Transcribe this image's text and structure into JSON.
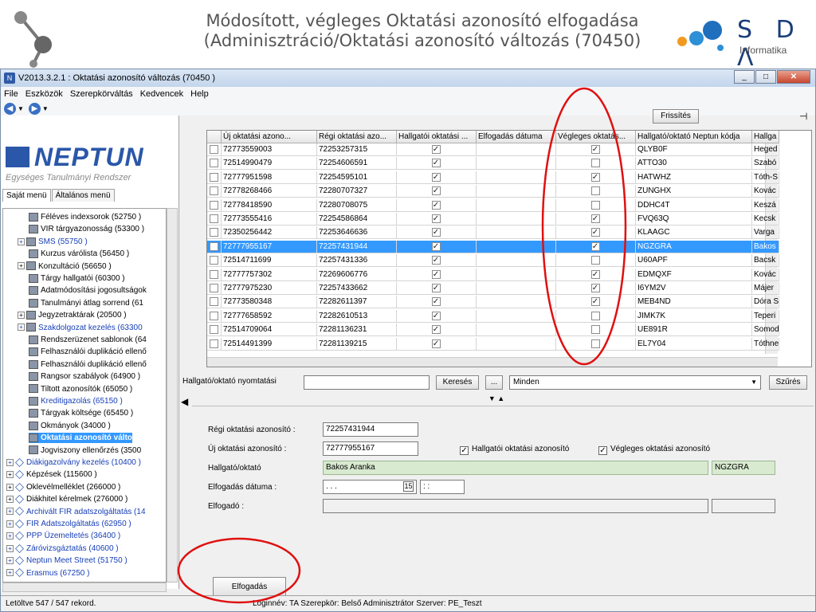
{
  "slide": {
    "title_line1": "Módosított, végleges  Oktatási azonosító elfogadása",
    "title_line2": "(Adminisztráció/Oktatási azonosító változás (70450)",
    "logo_letters": "S D Λ",
    "logo_sub": "Informatika"
  },
  "window": {
    "title": "V2013.3.2.1 : Oktatási azonosító változás (70450  )"
  },
  "menu": [
    "File",
    "Eszközök",
    "Szerepkörváltás",
    "Kedvencek",
    "Help"
  ],
  "brand": {
    "name": "NEPTUN",
    "subtitle": "Egységes Tanulmányi Rendszer"
  },
  "tabs": [
    "Saját menü",
    "Általános menü"
  ],
  "tree": [
    {
      "label": "Féléves indexsorok (52750 )",
      "indent": 2,
      "type": "node",
      "exp": "",
      "blue": false
    },
    {
      "label": "VIR tárgyazonosság (53300 )",
      "indent": 2,
      "type": "node",
      "exp": "",
      "blue": false
    },
    {
      "label": "SMS (55750 )",
      "indent": 1,
      "type": "node",
      "exp": "+",
      "blue": true
    },
    {
      "label": "Kurzus várólista (56450 )",
      "indent": 2,
      "type": "node",
      "exp": "",
      "blue": false
    },
    {
      "label": "Konzultáció (56650 )",
      "indent": 1,
      "type": "node",
      "exp": "+",
      "blue": false
    },
    {
      "label": "Tárgy hallgatói (60300 )",
      "indent": 2,
      "type": "node",
      "exp": "",
      "blue": false
    },
    {
      "label": "Adatmódosítási jogosultságok",
      "indent": 2,
      "type": "node",
      "exp": "",
      "blue": false
    },
    {
      "label": "Tanulmányi átlag sorrend (61",
      "indent": 2,
      "type": "node",
      "exp": "",
      "blue": false
    },
    {
      "label": "Jegyzetraktárak (20500 )",
      "indent": 1,
      "type": "node",
      "exp": "+",
      "blue": false
    },
    {
      "label": "Szakdolgozat kezelés (63300",
      "indent": 1,
      "type": "node",
      "exp": "+",
      "blue": true
    },
    {
      "label": "Rendszerüzenet sablonok (64",
      "indent": 2,
      "type": "node",
      "exp": "",
      "blue": false
    },
    {
      "label": "Felhasználói duplikáció ellenő",
      "indent": 2,
      "type": "node",
      "exp": "",
      "blue": false
    },
    {
      "label": "Felhasználói duplikáció ellenő",
      "indent": 2,
      "type": "node",
      "exp": "",
      "blue": false
    },
    {
      "label": "Rangsor szabályok (64900 )",
      "indent": 2,
      "type": "node",
      "exp": "",
      "blue": false
    },
    {
      "label": "Tiltott azonosítók (65050 )",
      "indent": 2,
      "type": "node",
      "exp": "",
      "blue": false
    },
    {
      "label": "Kreditigazolás (65150 )",
      "indent": 2,
      "type": "node",
      "exp": "",
      "blue": true
    },
    {
      "label": "Tárgyak költsége (65450 )",
      "indent": 2,
      "type": "node",
      "exp": "",
      "blue": false
    },
    {
      "label": "Okmányok (34000 )",
      "indent": 2,
      "type": "node",
      "exp": "",
      "blue": false
    },
    {
      "label": "Oktatási azonosító válto",
      "indent": 2,
      "type": "node",
      "exp": "",
      "blue": false,
      "selected": true
    },
    {
      "label": "Jogviszony ellenőrzés (3500",
      "indent": 2,
      "type": "node",
      "exp": "",
      "blue": false
    },
    {
      "label": "Diákigazolvány kezelés (10400 )",
      "indent": 0,
      "type": "dia",
      "exp": "+",
      "blue": true
    },
    {
      "label": "Képzések (115600 )",
      "indent": 0,
      "type": "dia",
      "exp": "+",
      "blue": false
    },
    {
      "label": "Oklevélmelléklet (266000 )",
      "indent": 0,
      "type": "dia",
      "exp": "+",
      "blue": false
    },
    {
      "label": "Diákhitel kérelmek (276000 )",
      "indent": 0,
      "type": "dia",
      "exp": "+",
      "blue": false
    },
    {
      "label": "Archivált FIR adatszolgáltatás (14",
      "indent": 0,
      "type": "dia",
      "exp": "+",
      "blue": true
    },
    {
      "label": "FIR Adatszolgáltatás (62950 )",
      "indent": 0,
      "type": "dia",
      "exp": "+",
      "blue": true
    },
    {
      "label": "PPP Üzemeltetés (36400 )",
      "indent": 0,
      "type": "dia",
      "exp": "+",
      "blue": true
    },
    {
      "label": "Záróvizsgáztatás (40600 )",
      "indent": 0,
      "type": "dia",
      "exp": "+",
      "blue": true
    },
    {
      "label": "Neptun Meet Street (51750 )",
      "indent": 0,
      "type": "dia",
      "exp": "+",
      "blue": true
    },
    {
      "label": "Erasmus (67250 )",
      "indent": 0,
      "type": "dia",
      "exp": "+",
      "blue": true
    }
  ],
  "refresh_label": "Frissítés",
  "grid": {
    "columns": [
      "Új oktatási azono...",
      "Régi oktatási azo...",
      "Hallgatói oktatási ...",
      "Elfogadás dátuma",
      "Végleges oktatás...",
      "Hallgató/oktató Neptun kódja",
      "Hallga"
    ],
    "rows": [
      {
        "new": "72773559003",
        "old": "72253257315",
        "h": true,
        "date": "",
        "v": true,
        "code": "QLYB0F",
        "name": "Heged"
      },
      {
        "new": "72514990479",
        "old": "72254606591",
        "h": true,
        "date": "",
        "v": false,
        "code": "ATTO30",
        "name": "Szabó"
      },
      {
        "new": "72777951598",
        "old": "72254595101",
        "h": true,
        "date": "",
        "v": true,
        "code": "HATWHZ",
        "name": "Tóth-S"
      },
      {
        "new": "72778268466",
        "old": "72280707327",
        "h": true,
        "date": "",
        "v": false,
        "code": "ZUNGHX",
        "name": "Kovác"
      },
      {
        "new": "72778418590",
        "old": "72280708075",
        "h": true,
        "date": "",
        "v": false,
        "code": "DDHC4T",
        "name": "Keszá"
      },
      {
        "new": "72773555416",
        "old": "72254586864",
        "h": true,
        "date": "",
        "v": true,
        "code": "FVQ63Q",
        "name": "Kecsk"
      },
      {
        "new": "72350256442",
        "old": "72253646636",
        "h": true,
        "date": "",
        "v": true,
        "code": "KLAAGC",
        "name": "Varga"
      },
      {
        "new": "72777955167",
        "old": "72257431944",
        "h": true,
        "date": "",
        "v": true,
        "code": "NGZGRA",
        "name": "Bakos",
        "selected": true
      },
      {
        "new": "72514711699",
        "old": "72257431336",
        "h": true,
        "date": "",
        "v": false,
        "code": "U60APF",
        "name": "Bacsk"
      },
      {
        "new": "72777757302",
        "old": "72269606776",
        "h": true,
        "date": "",
        "v": true,
        "code": "EDMQXF",
        "name": "Kovác"
      },
      {
        "new": "72777975230",
        "old": "72257433662",
        "h": true,
        "date": "",
        "v": true,
        "code": "I6YM2V",
        "name": "Májer"
      },
      {
        "new": "72773580348",
        "old": "72282611397",
        "h": true,
        "date": "",
        "v": true,
        "code": "MEB4ND",
        "name": "Dóra S"
      },
      {
        "new": "72777658592",
        "old": "72282610513",
        "h": true,
        "date": "",
        "v": false,
        "code": "JIMK7K",
        "name": "Teperi"
      },
      {
        "new": "72514709064",
        "old": "72281136231",
        "h": true,
        "date": "",
        "v": false,
        "code": "UE891R",
        "name": "Somod"
      },
      {
        "new": "72514491399",
        "old": "72281139215",
        "h": true,
        "date": "",
        "v": false,
        "code": "EL7Y04",
        "name": "Tóthne"
      }
    ]
  },
  "search": {
    "label": "Hallgató/oktató nyomtatási",
    "value": "",
    "button": "Keresés",
    "ellipsis": "...",
    "select_value": "Minden",
    "filter_button": "Szűrés"
  },
  "detail": {
    "old_label": "Régi oktatási azonosító :",
    "old_value": "72257431944",
    "new_label": "Új oktatási azonosító :",
    "new_value": "72777955167",
    "cb1_label": "Hallgatói oktatási azonosító",
    "cb2_label": "Végleges oktatási azonosító",
    "person_label": "Hallgató/oktató",
    "person_value": "Bakos Aranka",
    "person_code": "NGZGRA",
    "date_label": "Elfogadás dátuma :",
    "date_value": "  .   .   .",
    "time_value": " :  :",
    "acceptor_label": "Elfogadó :",
    "accept_button": "Elfogadás"
  },
  "status": {
    "records": "Letöltve 547 / 547 rekord.",
    "session": "Loginnév: TA   Szerepkör: Belső Adminisztrátor   Szerver: PE_Teszt"
  }
}
